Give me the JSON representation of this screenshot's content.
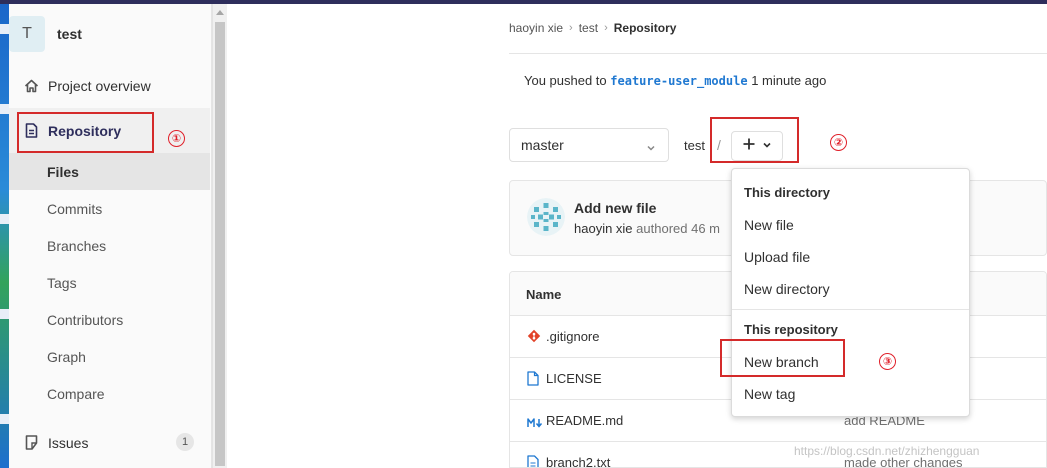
{
  "project": {
    "avatar_letter": "T",
    "name": "test"
  },
  "sidebar": {
    "project_overview": "Project overview",
    "repository": "Repository",
    "sub_items": [
      "Files",
      "Commits",
      "Branches",
      "Tags",
      "Contributors",
      "Graph",
      "Compare"
    ],
    "issues": {
      "label": "Issues",
      "count": "1"
    }
  },
  "annotations": [
    "①",
    "②",
    "③"
  ],
  "breadcrumb": [
    "haoyin xie",
    "test",
    "Repository"
  ],
  "push_notice": {
    "prefix": "You pushed to",
    "branch": "feature-user_module",
    "suffix": "1 minute ago"
  },
  "toolbar": {
    "branch": "master",
    "path": "test",
    "separator": "/"
  },
  "last_commit": {
    "title": "Add new file",
    "author": "haoyin xie",
    "meta": "authored 46 m"
  },
  "file_table": {
    "header": "Name",
    "rows": [
      {
        "name": ".gitignore",
        "message": ""
      },
      {
        "name": "LICENSE",
        "message": ""
      },
      {
        "name": "README.md",
        "message": "add README"
      },
      {
        "name": "branch2.txt",
        "message": "made other changes"
      }
    ]
  },
  "dropdown": {
    "section1": "This directory",
    "items1": [
      "New file",
      "Upload file",
      "New directory"
    ],
    "section2": "This repository",
    "items2": [
      "New branch",
      "New tag"
    ]
  },
  "watermark": "https://blog.csdn.net/zhizhengguan",
  "colors": {
    "nav_active": "#2e2e5c",
    "link": "#1f78d1",
    "annotation_red": "#e0202a",
    "gitignore_icon": "#e24329",
    "file_icon": "#1f78d1"
  }
}
